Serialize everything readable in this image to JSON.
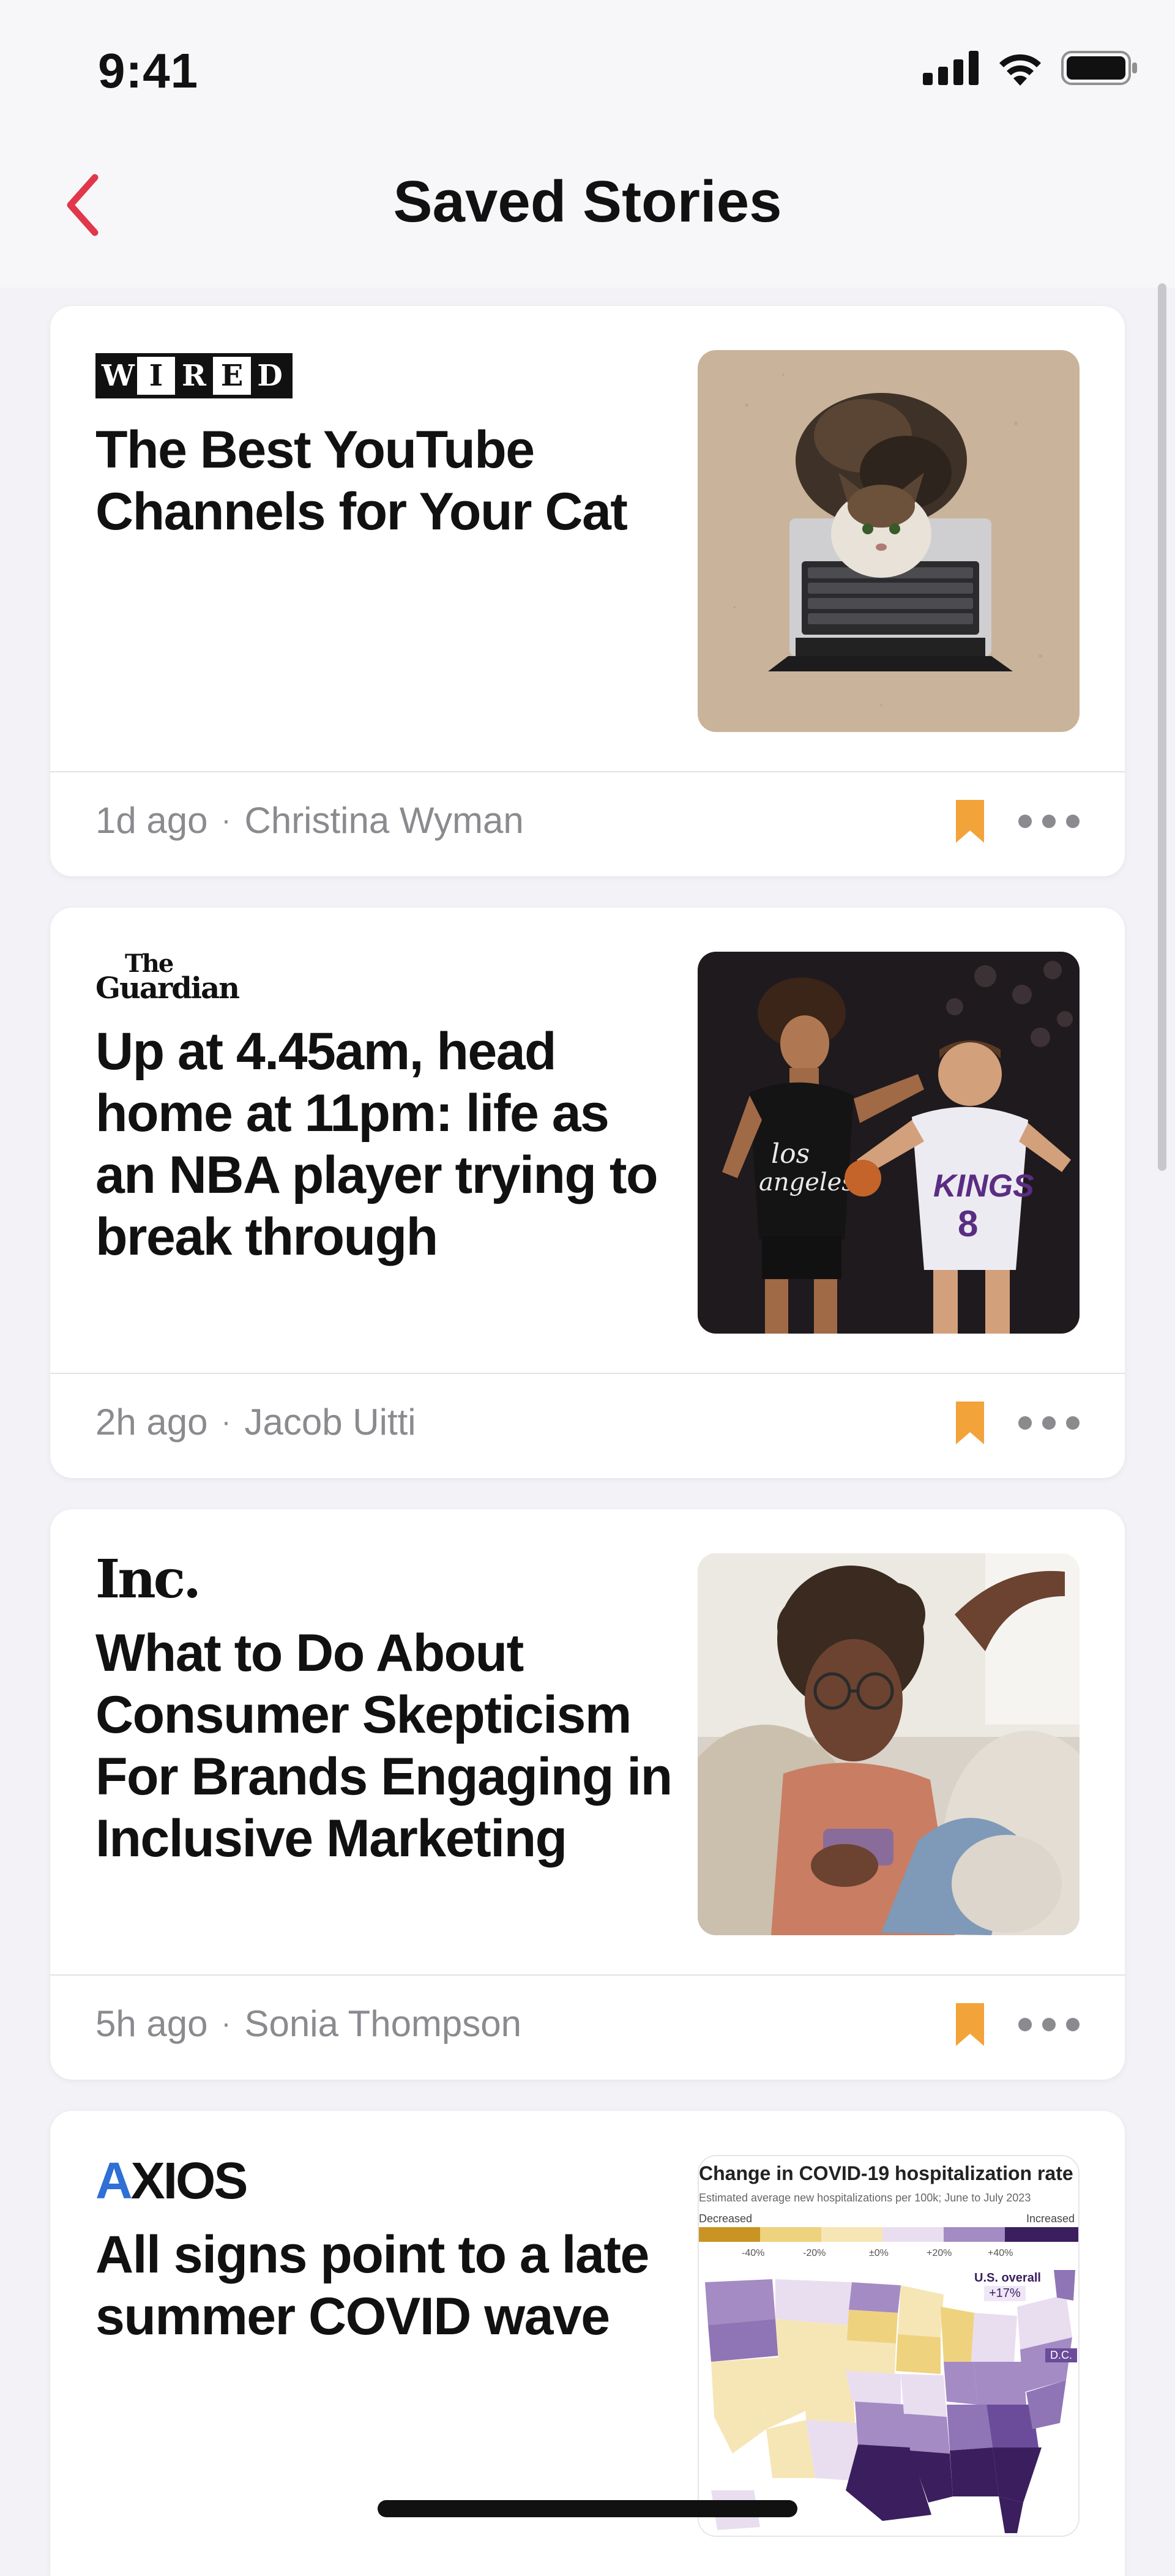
{
  "status_bar": {
    "time": "9:41"
  },
  "nav": {
    "title": "Saved Stories",
    "accent_color": "#e0384a"
  },
  "stories": [
    {
      "publisher": "WIRED",
      "headline": "The Best YouTube Channels for Your Cat",
      "time": "1d ago",
      "author": "Christina Wyman",
      "image": "cat-on-laptop"
    },
    {
      "publisher": "The Guardian",
      "headline": "Up at 4.45am, head home at 11pm: life as an NBA player trying to break through",
      "time": "2h ago",
      "author": "Jacob Uitti",
      "image": "basketball-players"
    },
    {
      "publisher": "Inc.",
      "headline": "What to Do About Consumer Skepticism For Brands Engaging in Inclusive Marketing",
      "time": "5h ago",
      "author": "Sonia Thompson",
      "image": "person-with-phone"
    },
    {
      "publisher": "AXIOS",
      "headline": "All signs point to a late summer COVID wave",
      "image": "covid-hospitalization-map",
      "map": {
        "title": "Change in COVID-19 hospitalization rate",
        "subtitle": "Estimated average new hospitalizations per 100k; June to July 2023",
        "decreased": "Decreased",
        "increased": "Increased",
        "ticks": [
          "-40%",
          "-20%",
          "±0%",
          "+20%",
          "+40%"
        ],
        "overall_label": "U.S. overall",
        "overall_value": "+17%",
        "dc_label": "D.C."
      }
    }
  ],
  "colors": {
    "bookmark": "#f2a33a",
    "meta_text": "#8a8a8f"
  }
}
